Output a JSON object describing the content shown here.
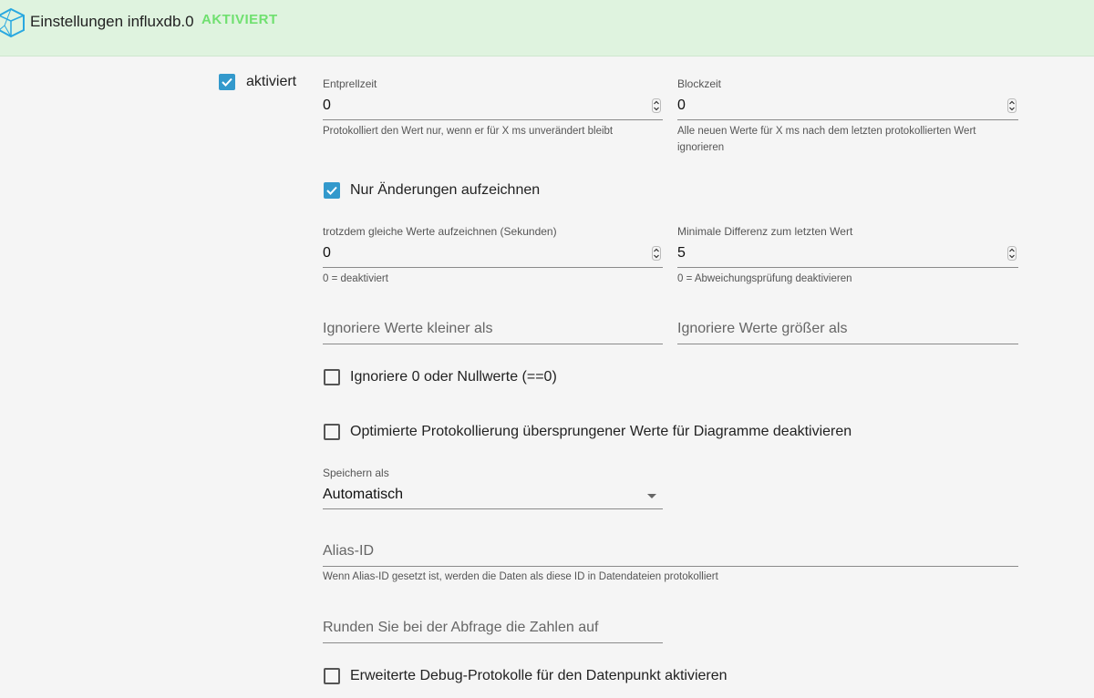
{
  "header": {
    "title": "Einstellungen influxdb.0",
    "status": "AKTIVIERT",
    "status_color": "#6fe06f",
    "background": "#dff3df",
    "logo_icon": "polyhedron-icon"
  },
  "enabled": {
    "label": "aktiviert",
    "checked": true
  },
  "debounce": {
    "label": "Entprellzeit",
    "value": "0",
    "help": "Protokolliert den Wert nur, wenn er für X ms unverändert bleibt"
  },
  "blocktime": {
    "label": "Blockzeit",
    "value": "0",
    "help": "Alle neuen Werte für X ms nach dem letzten protokollierten Wert ignorieren"
  },
  "changes_only": {
    "label": "Nur Änderungen aufzeichnen",
    "checked": true
  },
  "record_same": {
    "label": "trotzdem gleiche Werte aufzeichnen (Sekunden)",
    "value": "0",
    "help": "0 = deaktiviert"
  },
  "min_diff": {
    "label": "Minimale Differenz zum letzten Wert",
    "value": "5",
    "help": "0 = Abweichungsprüfung deaktivieren"
  },
  "ignore_below": {
    "placeholder": "Ignoriere Werte kleiner als"
  },
  "ignore_above": {
    "placeholder": "Ignoriere Werte größer als"
  },
  "ignore_zero": {
    "label": "Ignoriere 0 oder Nullwerte (==0)",
    "checked": false
  },
  "disable_skipped": {
    "label": "Optimierte Protokollierung übersprungener Werte für Diagramme deaktivieren",
    "checked": false
  },
  "store_as": {
    "label": "Speichern als",
    "value": "Automatisch"
  },
  "alias": {
    "placeholder": "Alias-ID",
    "help": "Wenn Alias-ID gesetzt ist, werden die Daten als diese ID in Datendateien protokolliert"
  },
  "round": {
    "placeholder": "Runden Sie bei der Abfrage die Zahlen auf"
  },
  "debug": {
    "label": "Erweiterte Debug-Protokolle für den Datenpunkt aktivieren",
    "checked": false
  },
  "accent_color": "#3399cc"
}
